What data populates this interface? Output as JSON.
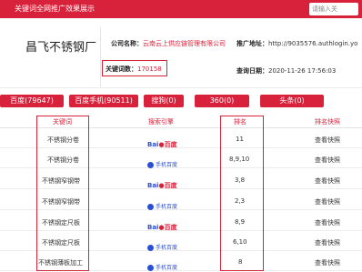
{
  "topbar": {
    "title": "关键词全网推广效果展示",
    "search_placeholder": "请输入关"
  },
  "company": {
    "name": "昌飞不锈钢厂",
    "company_label": "公司名称：",
    "company_value": "云南云上供应链管理有限公司",
    "promo_label": "推广地址：",
    "promo_value": "http://9035576.authlogin.yo",
    "kw_label": "关键词数：",
    "kw_value": "170158",
    "time_label": "查询日期：",
    "time_value": "2020-11-26 17:56:03"
  },
  "tabs": [
    {
      "label": "百度(79647)"
    },
    {
      "label": "百度手机(90511)"
    },
    {
      "label": "搜狗(0)"
    },
    {
      "label": "360(0)"
    },
    {
      "label": "头条(0)"
    }
  ],
  "table": {
    "headers": {
      "keyword": "关键词",
      "engine": "搜索引擎",
      "rank": "排名",
      "snapshot": "排名快照"
    },
    "rows": [
      {
        "keyword": "不锈钢分卷",
        "engine": "百度",
        "rank": "11",
        "snapshot": "查看快照"
      },
      {
        "keyword": "不锈钢分卷",
        "engine": "手机百度",
        "rank": "8,9,10",
        "snapshot": "查看快照"
      },
      {
        "keyword": "不锈钢窄钢带",
        "engine": "百度",
        "rank": "3,8",
        "snapshot": "查看快照"
      },
      {
        "keyword": "不锈钢窄钢带",
        "engine": "手机百度",
        "rank": "2,3",
        "snapshot": "查看快照"
      },
      {
        "keyword": "不锈钢定尺板",
        "engine": "百度",
        "rank": "8,9",
        "snapshot": "查看快照"
      },
      {
        "keyword": "不锈钢定尺板",
        "engine": "手机百度",
        "rank": "6,10",
        "snapshot": "查看快照"
      },
      {
        "keyword": "不锈钢薄板加工",
        "engine": "手机百度",
        "rank": "8",
        "snapshot": "查看快照"
      }
    ]
  },
  "colors": {
    "accent": "#d8213a",
    "baidu_blue": "#2a4fd6"
  }
}
